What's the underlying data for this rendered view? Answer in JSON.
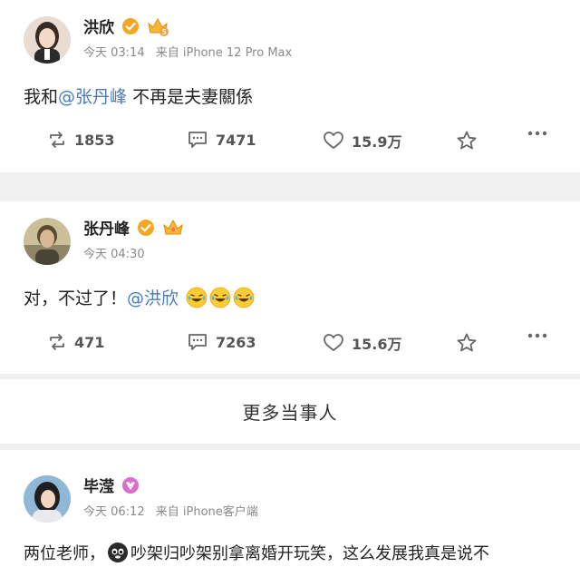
{
  "posts": [
    {
      "author": "洪欣",
      "time": "今天 03:14",
      "source": "来自 iPhone 12 Pro Max",
      "text_before": "我和",
      "mention": "@张丹峰",
      "text_after": " 不再是夫妻關係",
      "reposts": "1853",
      "comments": "7471",
      "likes": "15.9万",
      "level": "5"
    },
    {
      "author": "张丹峰",
      "time": "今天 04:30",
      "text_before": "对，不过了！",
      "mention": "@洪欣",
      "reposts": "471",
      "comments": "7263",
      "likes": "15.6万"
    },
    {
      "author": "毕滢",
      "time": "今天 06:12",
      "source": "来自 iPhone客户端",
      "text": "两位老师，",
      "text2": "吵架归吵架别拿离婚开玩笑，这么发展我真是说不"
    }
  ],
  "more_label": "更多当事人",
  "colors": {
    "mention": "#4a7bb7",
    "verified": "#f5a623",
    "vip_badge": "#d96fc9",
    "background": "#f1f1f1"
  },
  "icons": [
    "verified-icon",
    "crown-icon",
    "repost-icon",
    "comment-icon",
    "like-icon",
    "star-icon",
    "more-icon",
    "laugh-cry-emoji",
    "dog-emoji",
    "vip-icon"
  ]
}
